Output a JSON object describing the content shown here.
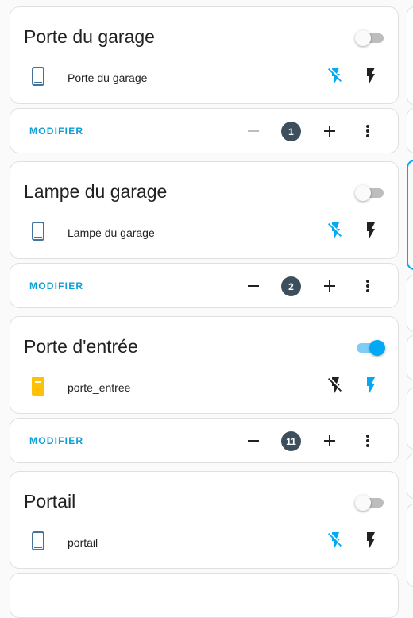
{
  "colors": {
    "accent": "#03a9f4",
    "modifier_text": "#0e9fd8",
    "badge_bg": "#3d4f5c",
    "door_closed_icon": "#44739e",
    "door_open_icon": "#ffc107",
    "toggle_off_track": "#bdbdbd",
    "disabled_minus": "#bdbdbd"
  },
  "cards": [
    {
      "title": "Porte du garage",
      "toggle_on": false,
      "device": {
        "name": "Porte du garage",
        "icon": "door-closed-icon",
        "icon_color": "#44739e"
      },
      "bolt_off_icon": "flash-off-icon",
      "bolt_off_color": "#03a9f4",
      "bolt_on_icon": "flash-icon",
      "bolt_on_color": "#212121",
      "modifier_label": "MODIFIER",
      "count": "1",
      "minus_disabled": true
    },
    {
      "title": "Lampe du garage",
      "toggle_on": false,
      "device": {
        "name": "Lampe du garage",
        "icon": "door-closed-icon",
        "icon_color": "#44739e"
      },
      "bolt_off_icon": "flash-off-icon",
      "bolt_off_color": "#03a9f4",
      "bolt_on_icon": "flash-icon",
      "bolt_on_color": "#212121",
      "modifier_label": "MODIFIER",
      "count": "2",
      "minus_disabled": false
    },
    {
      "title": "Porte d'entrée",
      "toggle_on": true,
      "device": {
        "name": "porte_entree",
        "icon": "door-open-icon",
        "icon_color": "#ffc107"
      },
      "bolt_off_icon": "flash-off-icon",
      "bolt_off_color": "#212121",
      "bolt_on_icon": "flash-icon",
      "bolt_on_color": "#03a9f4",
      "modifier_label": "MODIFIER",
      "count": "11",
      "minus_disabled": false
    },
    {
      "title": "Portail",
      "toggle_on": false,
      "device": {
        "name": "portail",
        "icon": "door-closed-icon",
        "icon_color": "#44739e"
      },
      "bolt_off_icon": "flash-off-icon",
      "bolt_off_color": "#03a9f4",
      "bolt_on_icon": "flash-icon",
      "bolt_on_color": "#212121"
    }
  ]
}
